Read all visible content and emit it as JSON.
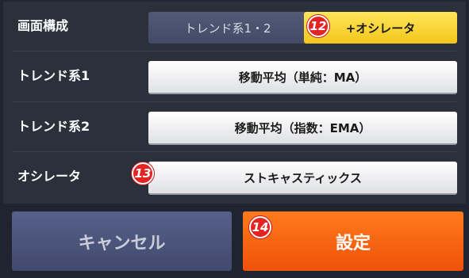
{
  "rows": {
    "composition": {
      "label": "画面構成",
      "options": [
        "トレンド系1・2",
        "+オシレータ"
      ],
      "selected": "+オシレータ"
    },
    "trend1": {
      "label": "トレンド系1",
      "value": "移動平均（単純：MA）"
    },
    "trend2": {
      "label": "トレンド系2",
      "value": "移動平均（指数：EMA）"
    },
    "oscillator": {
      "label": "オシレータ",
      "value": "ストキャスティックス"
    }
  },
  "badges": {
    "b12": "12",
    "b13": "13",
    "b14": "14"
  },
  "buttons": {
    "cancel": "キャンセル",
    "confirm": "設定"
  },
  "colors": {
    "accent_yellow": "#f8d532",
    "confirm_orange": "#f8620f",
    "badge_red": "#e52322",
    "cancel_blue": "#4b5479"
  }
}
